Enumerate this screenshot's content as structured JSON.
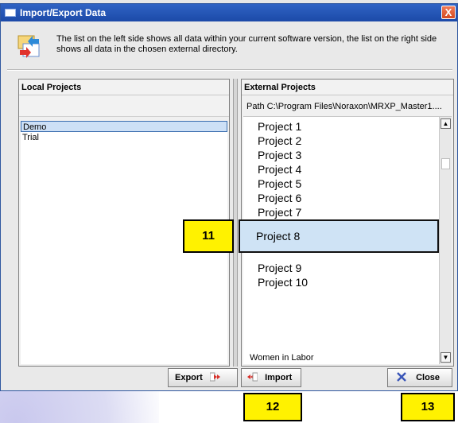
{
  "window": {
    "title": "Import/Export Data",
    "close_glyph": "X"
  },
  "info": {
    "text": "The list on the left side shows all data within your current software version, the list on the right side shows all data in the chosen external directory."
  },
  "local": {
    "header": "Local Projects",
    "items": [
      {
        "label": "Demo",
        "selected": true
      },
      {
        "label": "Trial",
        "selected": false
      }
    ]
  },
  "external": {
    "header": "External Projects",
    "path": "Path  C:\\Program Files\\Noraxon\\MRXP_Master1....",
    "items": [
      "Project 1",
      "Project 2",
      "Project 3",
      "Project 4",
      "Project 5",
      "Project 6",
      "Project 7",
      "Project 8",
      "Project 9",
      "Project 10"
    ],
    "highlighted": "Project 8",
    "bottom_item": "Women in Labor"
  },
  "buttons": {
    "export": "Export",
    "import": "Import",
    "close": "Close"
  },
  "callouts": {
    "c11": "11",
    "c12": "12",
    "c13": "13"
  },
  "colors": {
    "titlebar": "#2f63c4",
    "highlight": "#cfe3f5",
    "callout": "#fff200"
  },
  "icons": {
    "window": "window-icon",
    "info": "import-export-icon",
    "export": "export-arrow-icon",
    "import": "import-arrow-icon",
    "close": "close-x-icon"
  }
}
